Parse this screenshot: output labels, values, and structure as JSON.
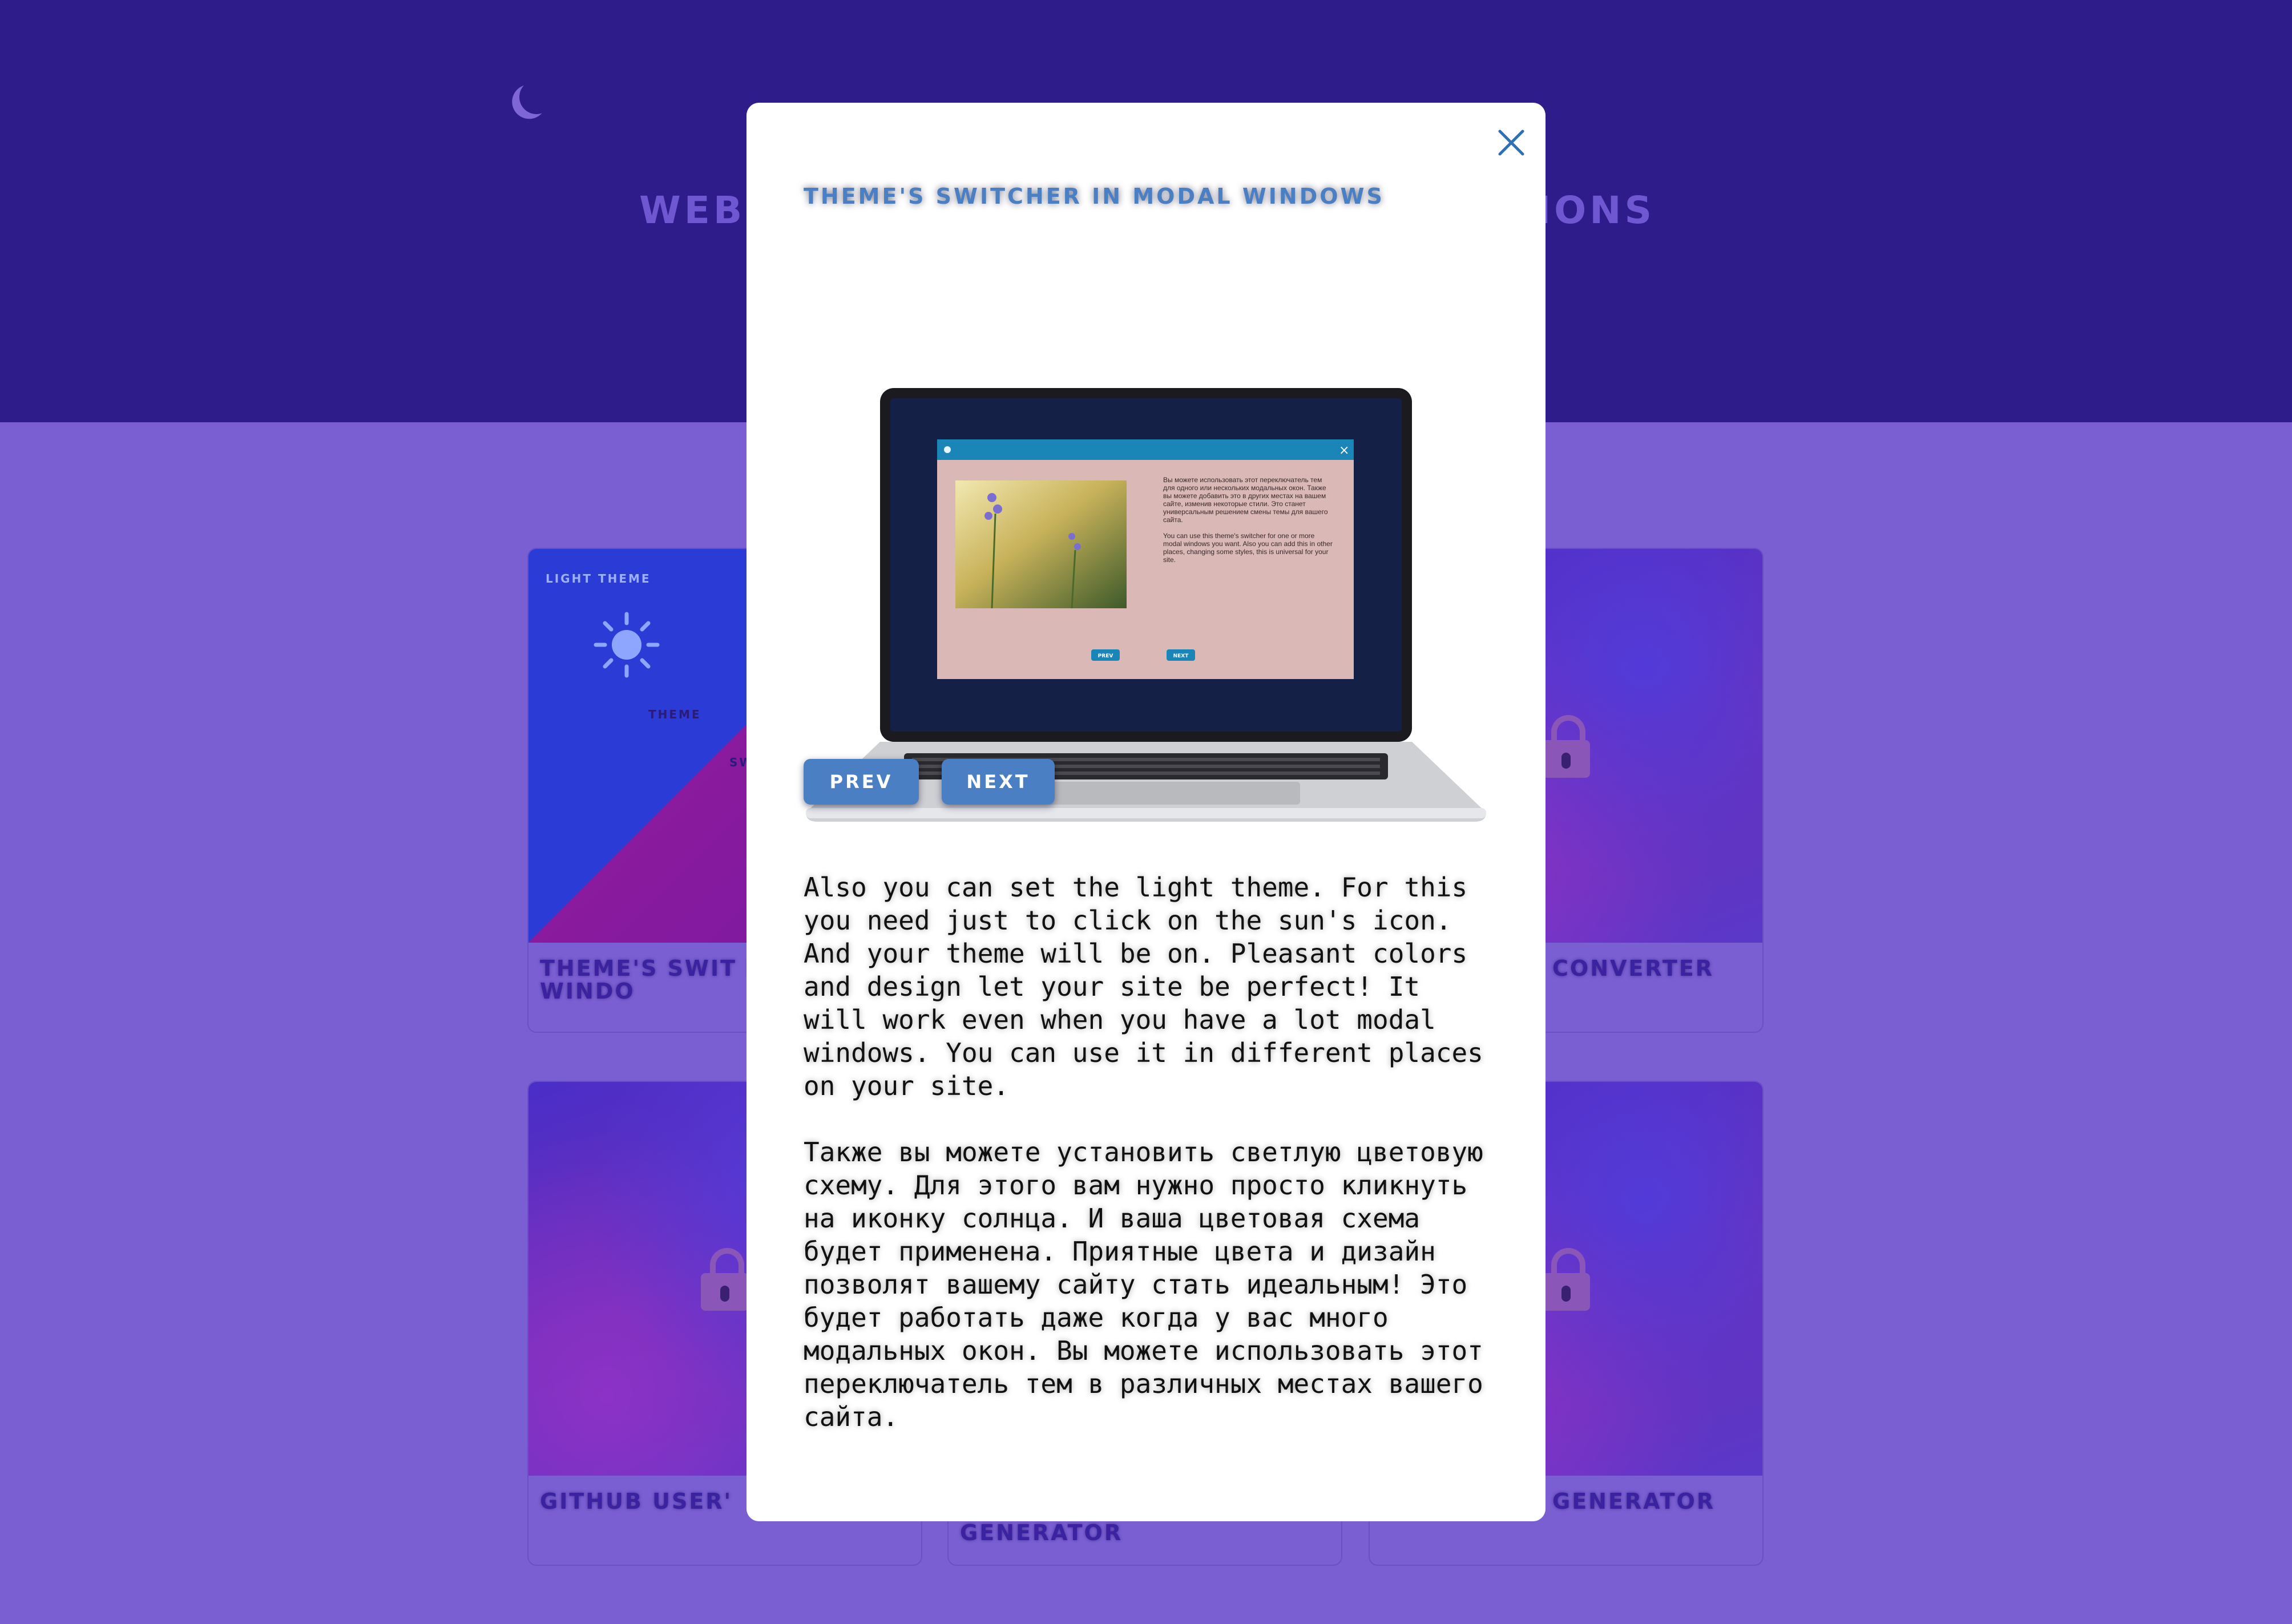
{
  "header": {
    "hero_title_left": "WEB",
    "hero_title_right": "IONS"
  },
  "cards": [
    {
      "title": "THEME'S SWIT MODAL WINDO",
      "preview": {
        "label": "LIGHT THEME",
        "word1": "THEME",
        "word2": "SW"
      }
    },
    {
      "title": "CONVERTER"
    },
    {
      "title": "GITHUB USER'"
    },
    {
      "title": "GENERATOR"
    },
    {
      "title": "GENERATOR"
    }
  ],
  "modal": {
    "title": "THEME'S SWITCHER IN MODAL WINDOWS",
    "prev_label": "PREV",
    "next_label": "NEXT",
    "paragraph_en": "Also you can set the light theme. For this you need just to click on the sun's icon. And your theme will be on. Pleasant colors and design let your site be perfect! It will work even when you have a lot modal windows. You can use it in different places on your site.",
    "paragraph_ru": "Также вы можете установить светлую цветовую схему. Для этого вам нужно просто кликнуть на иконку солнца. И ваша цветовая схема будет применена. Приятные цвета и дизайн позволят вашему сайту стать идеальным! Это будет работать даже когда у вас много модальных окон. Вы можете использовать этот переключатель тем в различных местах вашего сайта.",
    "laptop_screen": {
      "text_ru": "Вы можете использовать этот переключатель тем для одного или нескольких модальных окон. Также вы можете добавить это в других местах на вашем сайте, изменив некоторые стили. Это станет универсальным решением смены темы для вашего сайта.",
      "text_en": "You can use this theme's switcher for one or more modal windows you want. Also you can add this in other places, changing some styles, this is universal for your site.",
      "prev": "PREV",
      "next": "NEXT"
    }
  },
  "colors": {
    "header_bg": "#2e1c8a",
    "page_bg": "#7a5fd3",
    "accent": "#4a7fc4"
  }
}
